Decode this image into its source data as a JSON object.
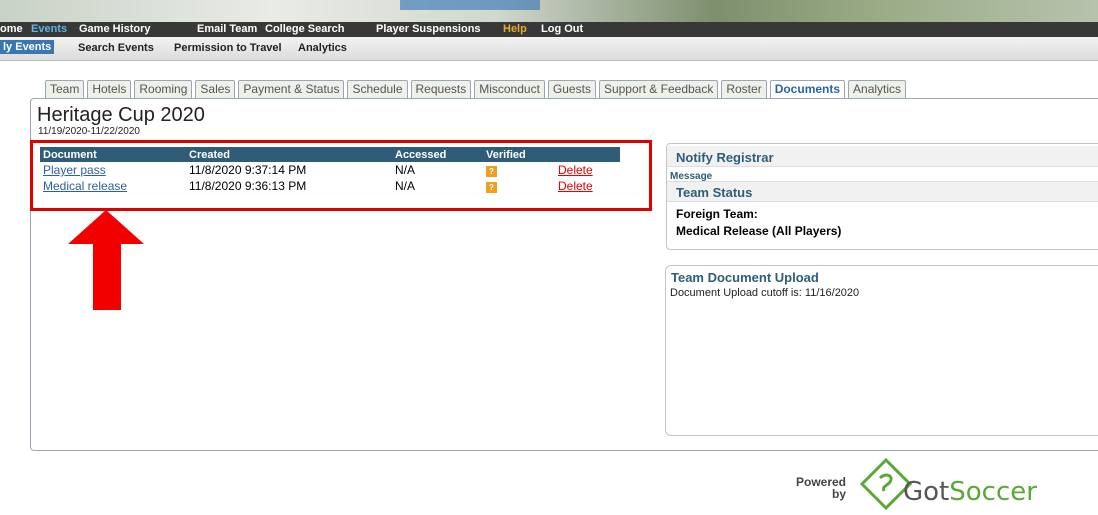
{
  "nav_primary": [
    "ome",
    "Events",
    "Game History",
    "Email Team",
    "College Search",
    "Player Suspensions",
    "Help",
    "Log Out"
  ],
  "nav_secondary": [
    "ly Events",
    "Search Events",
    "Permission to Travel",
    "Analytics"
  ],
  "tabs": [
    "Team",
    "Hotels",
    "Rooming",
    "Sales",
    "Payment & Status",
    "Schedule",
    "Requests",
    "Misconduct",
    "Guests",
    "Support & Feedback",
    "Roster",
    "Documents",
    "Analytics"
  ],
  "active_tab": "Documents",
  "event": {
    "title": "Heritage Cup 2020",
    "dates": "11/19/2020-11/22/2020"
  },
  "documents_table": {
    "headers": [
      "Document",
      "Created",
      "Accessed",
      "Verified",
      ""
    ],
    "rows": [
      {
        "document": "Player pass",
        "created": "11/8/2020 9:37:14 PM",
        "accessed": "N/A",
        "verified": "?",
        "action": "Delete"
      },
      {
        "document": "Medical release",
        "created": "11/8/2020 9:36:13 PM",
        "accessed": "N/A",
        "verified": "?",
        "action": "Delete"
      }
    ]
  },
  "notify": {
    "title": "Notify Registrar",
    "message_label": "Message"
  },
  "team_status": {
    "title": "Team Status",
    "line1": "Foreign Team:",
    "line2": "Medical Release (All Players)"
  },
  "upload": {
    "title": "Team Document Upload",
    "cutoff_text": "Document Upload cutoff is: 11/16/2020"
  },
  "footer": {
    "powered": "Powered",
    "by": "by",
    "brand_got": "Got",
    "brand_soccer": "Soccer"
  },
  "colors": {
    "highlight": "#e00000",
    "header_bg": "#2f5d78",
    "link": "#2b5fa7",
    "delete": "#e00000"
  }
}
